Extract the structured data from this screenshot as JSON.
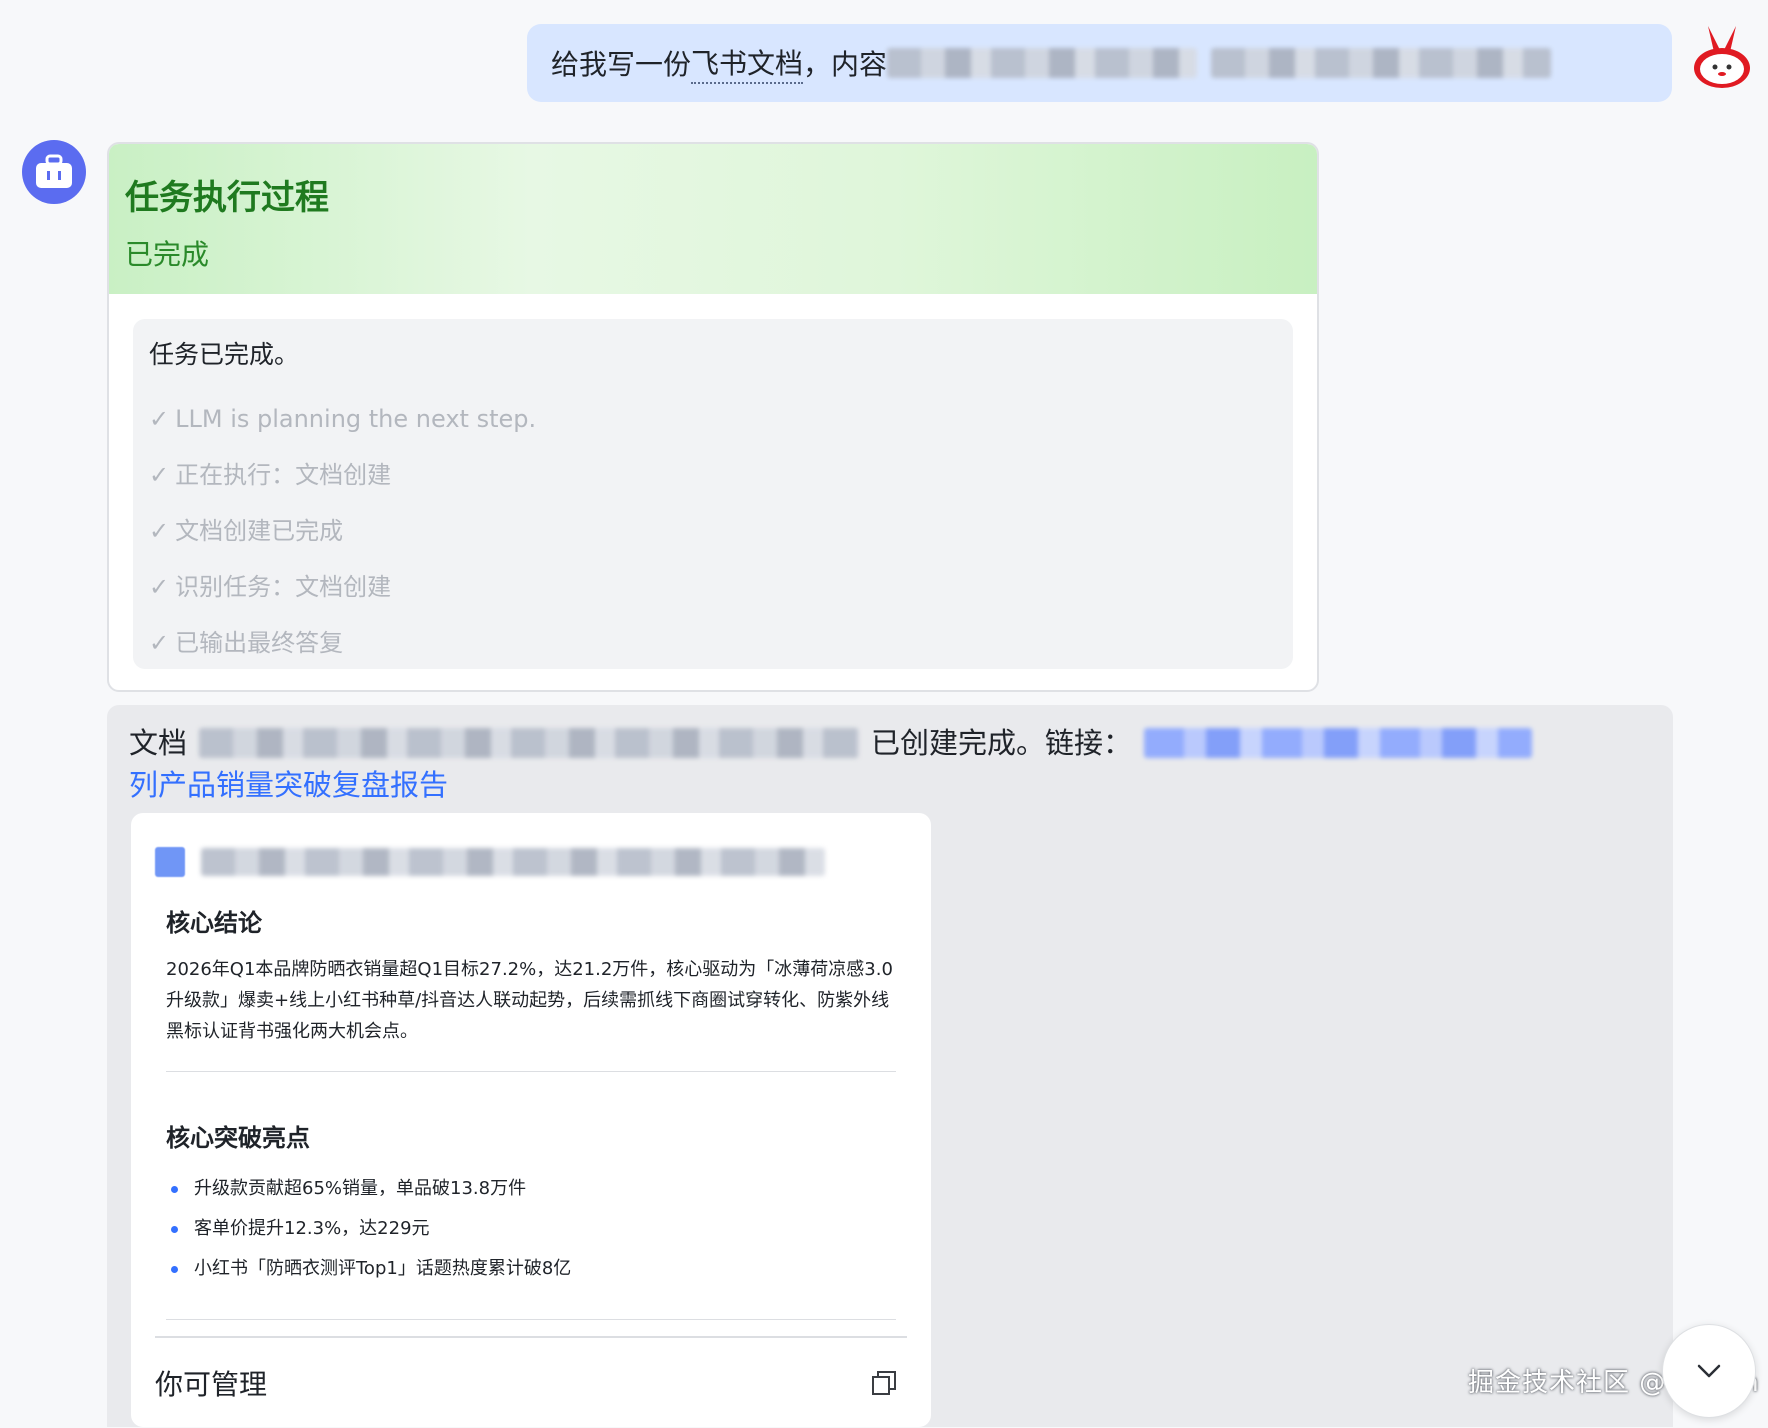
{
  "user_message": {
    "prefix": "给我写一份",
    "link_text": "飞书文档",
    "suffix": "，内容"
  },
  "task": {
    "title": "任务执行过程",
    "status": "已完成",
    "done_text": "任务已完成。",
    "check_mark": "✓",
    "steps": [
      "LLM is planning the next step.",
      "正在执行：文档创建",
      "文档创建已完成",
      "识别任务：文档创建",
      "已输出最终答复"
    ]
  },
  "result": {
    "doc_label": "文档",
    "created_text": "已创建完成。链接：",
    "link_tail": "列产品销量突破复盘报告"
  },
  "doc_card": {
    "section1_title": "核心结论",
    "section1_body": "2026年Q1本品牌防晒衣销量超Q1目标27.2%，达21.2万件，核心驱动为「冰薄荷凉感3.0升级款」爆卖+线上小红书种草/抖音达人联动起势，后续需抓线下商圈试穿转化、防紫外线黑标认证背书强化两大机会点。",
    "section2_title": "核心突破亮点",
    "bullets": [
      "升级款贡献超65%销量，单品破13.8万件",
      "客单价提升12.3%，达229元",
      "小红书「防晒衣测评Top1」话题热度累计破8亿"
    ],
    "footer_label": "你可管理"
  },
  "watermark": "掘金技术社区 @ voelin",
  "colors": {
    "accent_blue": "#3370ff",
    "user_bubble": "#d8e6ff",
    "task_green": "#1f7a1f"
  }
}
